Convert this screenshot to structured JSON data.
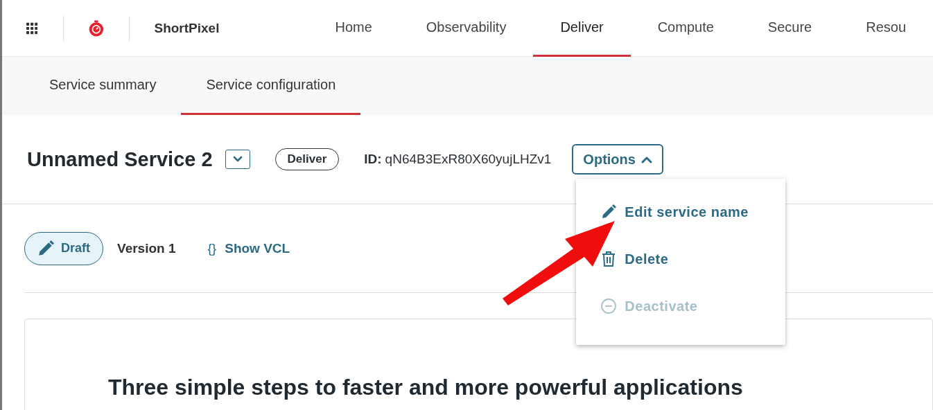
{
  "top_nav": {
    "brand": "ShortPixel",
    "items": [
      {
        "label": "Home",
        "selected": false
      },
      {
        "label": "Observability",
        "selected": false
      },
      {
        "label": "Deliver",
        "selected": true
      },
      {
        "label": "Compute",
        "selected": false
      },
      {
        "label": "Secure",
        "selected": false
      },
      {
        "label": "Resou",
        "selected": false
      }
    ]
  },
  "sub_tabs": [
    {
      "label": "Service summary",
      "selected": false
    },
    {
      "label": "Service configuration",
      "selected": true
    }
  ],
  "service": {
    "title": "Unnamed Service 2",
    "badge": "Deliver",
    "id_label": "ID:",
    "id_value": "qN64B3ExR80X60yujLHZv1",
    "options_button": "Options"
  },
  "options_menu": [
    {
      "kind": "pencil",
      "label": "Edit service name",
      "disabled": false
    },
    {
      "kind": "trash",
      "label": "Delete",
      "disabled": false
    },
    {
      "kind": "minus",
      "label": "Deactivate",
      "disabled": true
    }
  ],
  "version_bar": {
    "status": "Draft",
    "version": "Version 1",
    "vcl_icon": "{}",
    "vcl_link": "Show VCL"
  },
  "card": {
    "heading": "Three simple steps to faster and more powerful applications"
  }
}
